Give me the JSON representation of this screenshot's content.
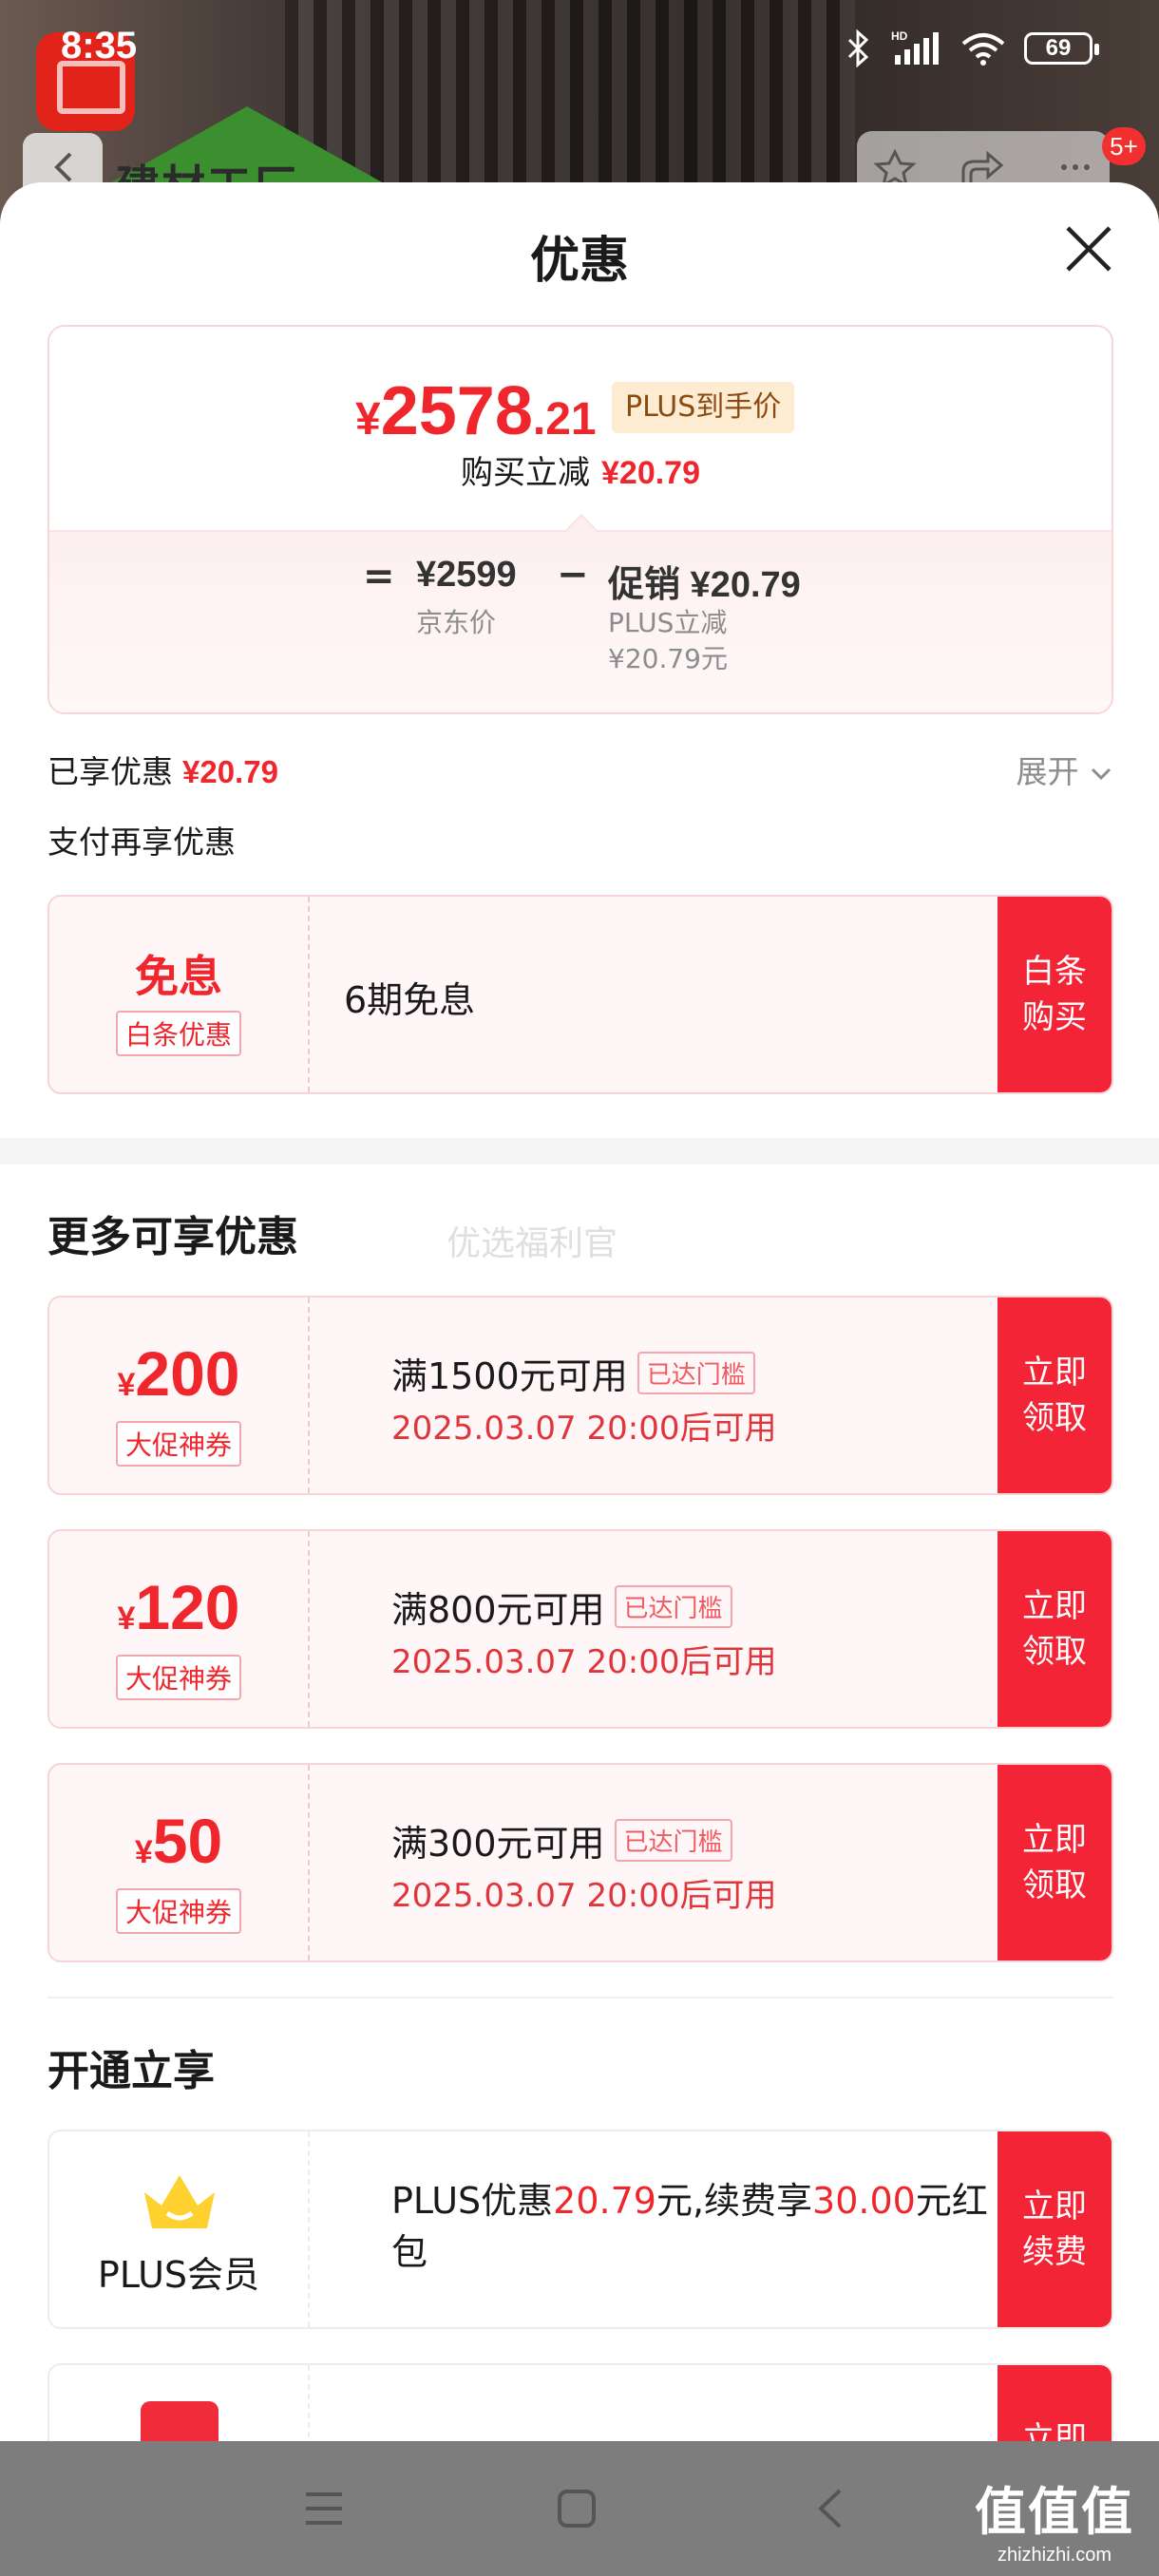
{
  "status_bar": {
    "time": "8:35",
    "network": "HD",
    "battery": "69"
  },
  "background": {
    "brand_text": "建材工厂",
    "badge": "5+"
  },
  "sheet": {
    "title": "优惠",
    "price_card": {
      "currency": "¥",
      "final_int": "2578",
      "final_dec": ".21",
      "plus_tag": "PLUS到手价",
      "reduce_label": "购买立减",
      "reduce_value": "¥20.79",
      "equals": "=",
      "minus": "−",
      "jd_price": "¥2599",
      "jd_price_label": "京东价",
      "promo_label": "促销 ¥20.79",
      "promo_sub1": "PLUS立减",
      "promo_sub2": "¥20.79元"
    },
    "enjoyed": {
      "label": "已享优惠",
      "value": "¥20.79",
      "expand": "展开"
    },
    "pay_title": "支付再享优惠",
    "baitiao": {
      "title": "免息",
      "tag": "白条优惠",
      "desc": "6期免息",
      "action_1": "白条",
      "action_2": "购买"
    },
    "more_title": "更多可享优惠",
    "watermark": "优选福利官",
    "coupons": [
      {
        "sym": "¥",
        "amount": "200",
        "tag": "大促神券",
        "cond": "满1500元可用",
        "reached": "已达门槛",
        "avail": "2025.03.07 20:00后可用",
        "action_1": "立即",
        "action_2": "领取"
      },
      {
        "sym": "¥",
        "amount": "120",
        "tag": "大促神券",
        "cond": "满800元可用",
        "reached": "已达门槛",
        "avail": "2025.03.07 20:00后可用",
        "action_1": "立即",
        "action_2": "领取"
      },
      {
        "sym": "¥",
        "amount": "50",
        "tag": "大促神券",
        "cond": "满300元可用",
        "reached": "已达门槛",
        "avail": "2025.03.07 20:00后可用",
        "action_1": "立即",
        "action_2": "领取"
      }
    ],
    "open_title": "开通立享",
    "plus": {
      "label": "PLUS会员",
      "desc_1": "PLUS优惠",
      "amount_1": "20.79",
      "desc_2": "元,续费享",
      "amount_2": "30.00",
      "desc_3": "元红包",
      "action_1": "立即",
      "action_2": "续费"
    },
    "next_card": {
      "action_1": "立即"
    }
  },
  "site_mark": {
    "big": "值值值",
    "small": "zhizhizhi.com"
  },
  "colors": {
    "accent": "#f0262d",
    "button": "#f42437",
    "tag_bg": "#fdecd2"
  }
}
